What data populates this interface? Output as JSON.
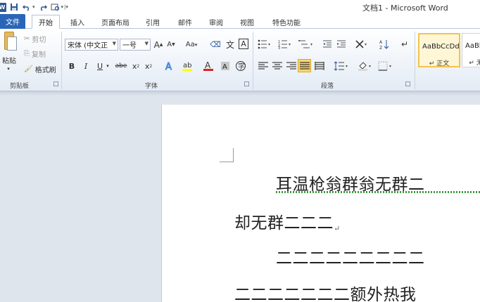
{
  "window": {
    "title": "文档1 - Microsoft Word"
  },
  "quick_access": [
    "word-icon",
    "save-icon",
    "undo-icon",
    "redo-icon",
    "print-preview-icon",
    "customize-icon"
  ],
  "tabs": [
    {
      "label": "文件"
    },
    {
      "label": "开始"
    },
    {
      "label": "插入"
    },
    {
      "label": "页面布局"
    },
    {
      "label": "引用"
    },
    {
      "label": "邮件"
    },
    {
      "label": "审阅"
    },
    {
      "label": "视图"
    },
    {
      "label": "特色功能"
    }
  ],
  "ribbon": {
    "clipboard": {
      "paste": "粘贴",
      "cut": "剪切",
      "copy": "复制",
      "format_painter": "格式刷",
      "group_label": "剪贴板"
    },
    "font": {
      "font_name": "宋体 (中文正",
      "font_size": "一号",
      "grow": "A",
      "shrink": "A",
      "change_case": "Aa",
      "pinyin": "文",
      "border_char": "A",
      "bold": "B",
      "italic": "I",
      "underline": "U",
      "strike": "abe",
      "subscript": "x",
      "superscript": "x",
      "group_label": "字体"
    },
    "paragraph": {
      "group_label": "段落"
    },
    "styles": {
      "items": [
        {
          "sample": "AaBbCcDd",
          "name": "↵ 正文"
        },
        {
          "sample": "AaBb",
          "name": "↵ 无"
        }
      ]
    }
  },
  "document": {
    "lines": [
      "耳温枪翁群翁无群二",
      "却无群二二二",
      "二二二二二二二二二",
      "二二二二二二二额外热我"
    ]
  }
}
